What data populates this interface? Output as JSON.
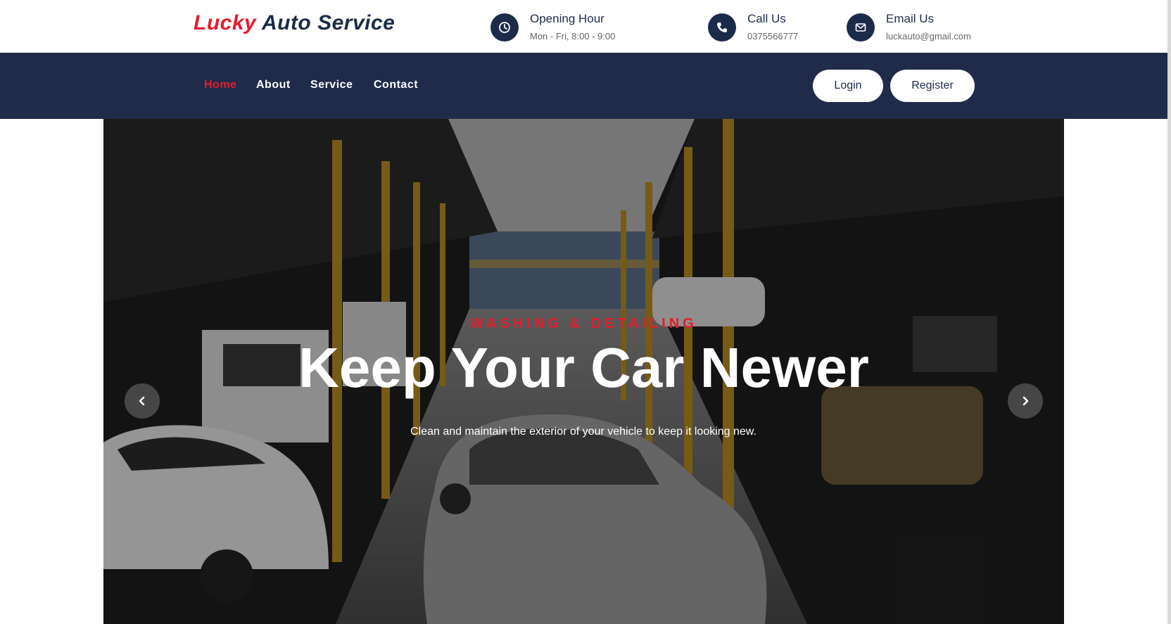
{
  "brand": {
    "name_accent": "Lucky",
    "name_main": "Auto Service"
  },
  "info": [
    {
      "title": "Opening Hour",
      "value": "Mon - Fri, 8:00 - 9:00",
      "icon": "clock-icon"
    },
    {
      "title": "Call Us",
      "value": "0375566777",
      "icon": "phone-icon"
    },
    {
      "title": "Email Us",
      "value": "luckauto@gmail.com",
      "icon": "envelope-icon"
    }
  ],
  "nav": {
    "items": [
      {
        "label": "Home",
        "active": true
      },
      {
        "label": "About"
      },
      {
        "label": "Service"
      },
      {
        "label": "Contact"
      }
    ],
    "login": "Login",
    "register": "Register"
  },
  "hero": {
    "eyebrow": "WASHING & DETAILING",
    "headline": "Keep Your Car Newer",
    "description": "Clean and maintain the exterior of your vehicle to keep it looking new."
  },
  "colors": {
    "accent": "#e31e2d",
    "navy": "#1f2b49"
  }
}
